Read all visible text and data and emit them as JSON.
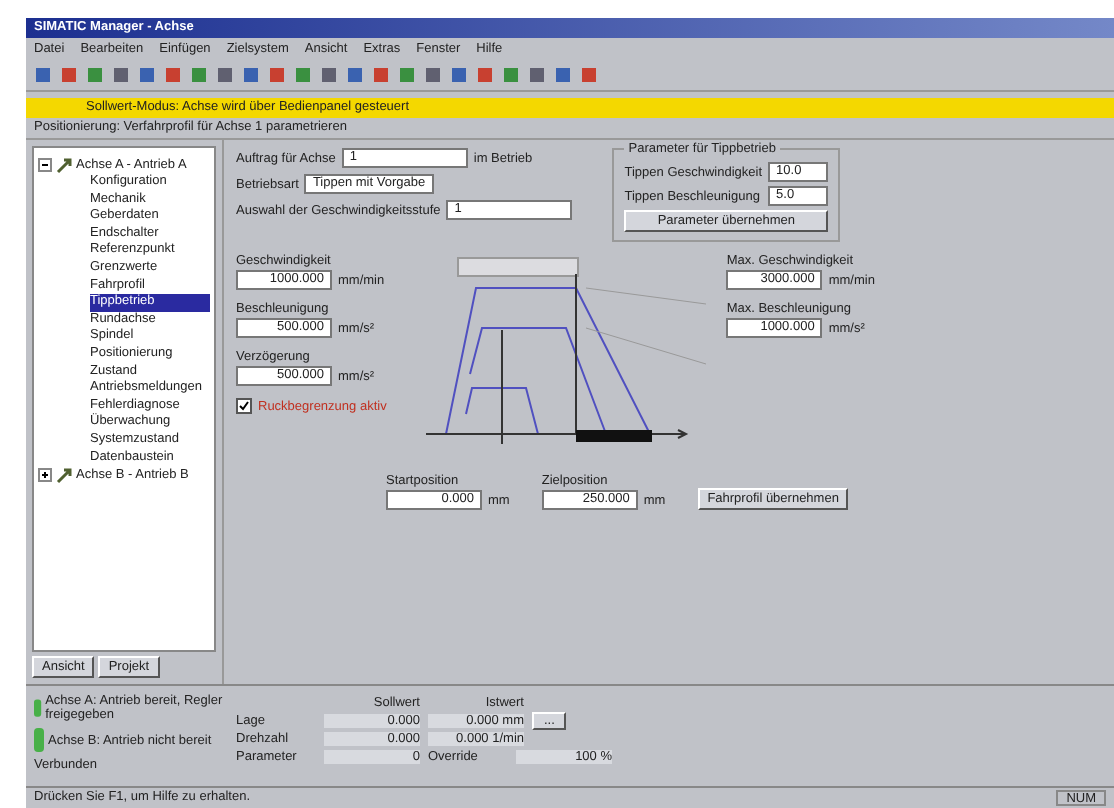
{
  "window": {
    "title": "SIMATIC Manager - Achse"
  },
  "menu": [
    "Datei",
    "Bearbeiten",
    "Einfügen",
    "Zielsystem",
    "Ansicht",
    "Extras",
    "Fenster",
    "Hilfe"
  ],
  "notice": "Sollwert-Modus: Achse wird über Bedienpanel gesteuert",
  "breadcrumb": "Positionierung: Verfahrprofil für Achse 1 parametrieren",
  "tree": [
    {
      "label": "Achse A - Antrieb A",
      "expanded": true,
      "children": [
        {
          "label": "Konfiguration",
          "selected": false
        },
        {
          "label": "Mechanik",
          "selected": false
        },
        {
          "label": "Geberdaten",
          "selected": false
        },
        {
          "label": "Endschalter",
          "selected": false
        },
        {
          "label": "Referenzpunkt",
          "selected": false
        },
        {
          "label": "Grenzwerte",
          "selected": false
        },
        {
          "label": "Fahrprofil",
          "selected": false
        },
        {
          "label": "Tippbetrieb",
          "selected": true
        },
        {
          "label": "Rundachse",
          "selected": false
        },
        {
          "label": "Spindel",
          "selected": false
        },
        {
          "label": "Positionierung",
          "selected": false
        },
        {
          "label": "Zustand",
          "selected": false
        },
        {
          "label": "Antriebsmeldungen",
          "selected": false
        },
        {
          "label": "Fehlerdiagnose",
          "selected": false
        },
        {
          "label": "Überwachung",
          "selected": false
        },
        {
          "label": "Systemzustand",
          "selected": false
        },
        {
          "label": "Datenbaustein",
          "selected": false
        }
      ]
    },
    {
      "label": "Achse B - Antrieb B",
      "expanded": false
    }
  ],
  "tree_tabs": [
    "Ansicht",
    "Projekt"
  ],
  "form": {
    "top": [
      {
        "label": "Auftrag für Achse",
        "value": "1",
        "suffix": "im Betrieb"
      },
      {
        "label": "Betriebsart",
        "value": "Tippen mit Vorgabe"
      },
      {
        "label": "Auswahl der Geschwindigkeitsstufe",
        "value": "1"
      }
    ],
    "group": {
      "title": "Parameter für Tippbetrieb",
      "rows": [
        {
          "label": "Tippen Geschwindigkeit",
          "value": "10.0"
        },
        {
          "label": "Tippen Beschleunigung",
          "value": "5.0"
        }
      ],
      "button": "Parameter übernehmen"
    },
    "left": [
      {
        "label": "Geschwindigkeit",
        "value": "1000.000",
        "unit": "mm/min"
      },
      {
        "label": "Beschleunigung",
        "value": "500.000",
        "unit": "mm/s²"
      },
      {
        "label": "Verzögerung",
        "value": "500.000",
        "unit": "mm/s²"
      }
    ],
    "check": {
      "label": "Ruckbegrenzung aktiv",
      "checked": true
    },
    "right": [
      {
        "label": "Max. Geschwindigkeit",
        "value": "3000.000",
        "unit": "mm/min"
      },
      {
        "label": "Max. Beschleunigung",
        "value": "1000.000",
        "unit": "mm/s²"
      }
    ],
    "bottom": [
      {
        "label": "Startposition",
        "value": "0.000",
        "unit": "mm"
      },
      {
        "label": "Zielposition",
        "value": "250.000",
        "unit": "mm"
      }
    ],
    "apply": "Fahrprofil übernehmen"
  },
  "status_panel": {
    "messages": [
      {
        "text": "Achse A: Antrieb bereit, Regler freigegeben"
      },
      {
        "text": "Achse B: Antrieb nicht bereit"
      }
    ],
    "headers": [
      "Sollwert",
      "Istwert"
    ],
    "rows": [
      {
        "label": "Lage",
        "set": "0.000",
        "actual": "0.000 mm"
      },
      {
        "label": "Drehzahl",
        "set": "0.000",
        "actual": "0.000 1/min"
      }
    ],
    "button": "...",
    "extra": [
      {
        "label": "Parameter",
        "value": "0"
      },
      {
        "label": "Override",
        "value": "100 %"
      }
    ],
    "footer": "Verbunden"
  },
  "status_bar": {
    "left": "Drücken Sie F1, um Hilfe zu erhalten.",
    "right": "NUM"
  }
}
